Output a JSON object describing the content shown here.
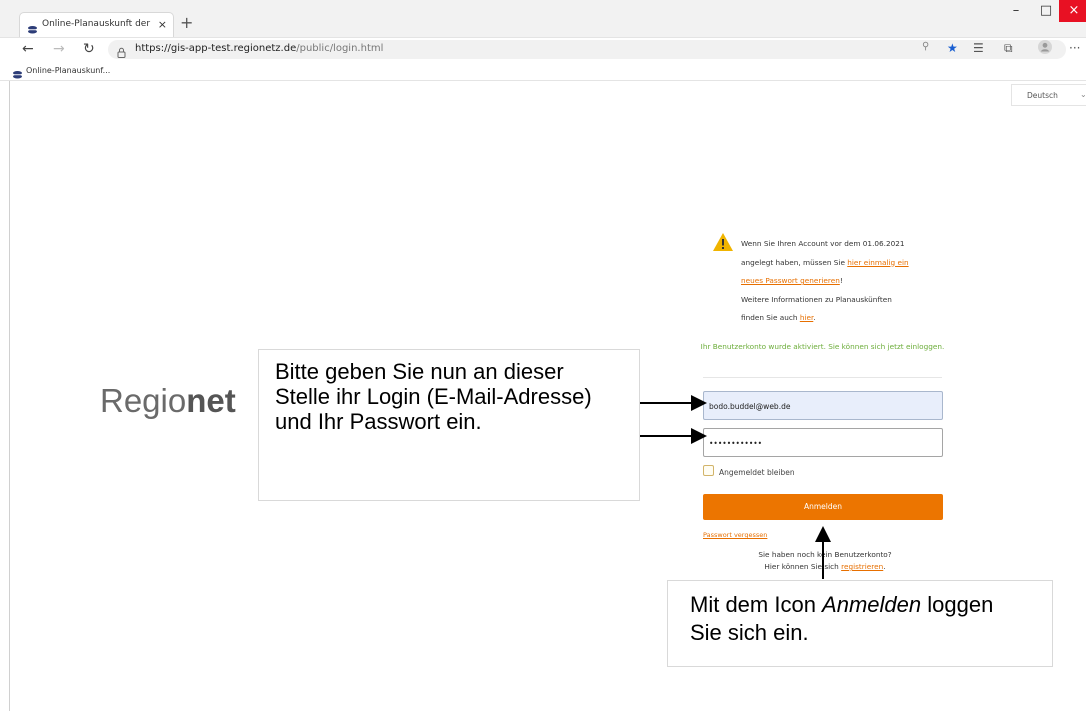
{
  "browser": {
    "tab_title": "Online-Planauskunft der Regionetz",
    "tab_close": "×",
    "new_tab": "+",
    "url_host": "https://gis-app-test.regionetz.de",
    "url_path": "/public/login.html",
    "bookmark_label": "Online-Planauskunf...",
    "window_controls": {
      "minimize": "–",
      "maximize": "□",
      "close": "×"
    },
    "icons": [
      "back-icon",
      "forward-icon",
      "reload-icon",
      "lock-icon",
      "zoom-icon",
      "star-icon",
      "favorites-icon",
      "collections-icon",
      "profile-icon",
      "more-icon"
    ]
  },
  "page": {
    "language": "Deutsch",
    "logo_regular": "Regio",
    "logo_bold": "net",
    "notice": {
      "line1": "Wenn Sie Ihren Account vor dem 01.06.2021",
      "line2_prefix": "angelegt haben, müssen Sie ",
      "line2_link": "hier einmalig ein",
      "line3_link": "neues Passwort generieren",
      "line3_suffix": "!",
      "line4": "Weitere Informationen zu Planauskünften",
      "line5_prefix": "finden Sie auch ",
      "line5_link": "hier",
      "line5_suffix": "."
    },
    "success_message": "Ihr Benutzerkonto wurde aktiviert. Sie können sich jetzt einloggen.",
    "email_value": "bodo.buddel@web.de",
    "password_value": "••••••••••••",
    "remember_label": "Angemeldet bleiben",
    "login_button": "Anmelden",
    "forgot_password": "Passwort vergessen",
    "register_line1": "Sie haben noch kein Benutzerkonto?",
    "register_prefix": "Hier können Sie sich ",
    "register_link": "registrieren",
    "register_suffix": "."
  },
  "annotations": {
    "callout_1": "Bitte geben Sie nun  an dieser Stelle ihr Login (E-Mail-Adresse) und Ihr Passwort ein.",
    "callout_2_prefix": "Mit dem Icon ",
    "callout_2_emphasis": "Anmelden",
    "callout_2_suffix": " loggen Sie sich ein."
  }
}
